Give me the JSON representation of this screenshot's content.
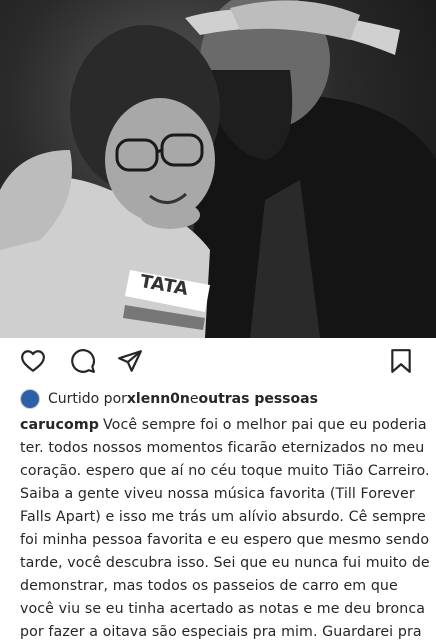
{
  "post": {
    "photo_alt": "Black and white photo of a woman with glasses embracing a bearded man in a hat",
    "shirt_text": "TATA"
  },
  "actions": {
    "like_icon": "heart-outline-icon",
    "comment_icon": "comment-bubble-icon",
    "share_icon": "paper-plane-icon",
    "save_icon": "bookmark-icon"
  },
  "likes": {
    "prefix": "Curtido por ",
    "user": "xlenn0n",
    "middle": " e ",
    "others": "outras pessoas"
  },
  "caption": {
    "username": "carucomp",
    "text": "Você sempre foi o melhor pai que eu poderia ter. todos nossos momentos ficarão eternizados no meu coração. espero que aí no céu toque muito Tião Carreiro. Saiba a gente viveu nossa música favorita (Till Forever Falls Apart) e isso me trás um alívio absurdo. Cê sempre foi minha pessoa favorita e eu espero que mesmo sendo tarde, você descubra isso. Sei que eu nunca fui muito de demonstrar, mas todos os passeios de carro em que você viu se eu tinha acertado as notas e me deu bronca por fazer a oitava são especiais pra mim. Guardarei pra sempre você em mim. Eu te amo infinitamente pai.",
    "emoji": "❤️"
  },
  "colors": {
    "text": "#262626",
    "heart": "#e0245e"
  }
}
